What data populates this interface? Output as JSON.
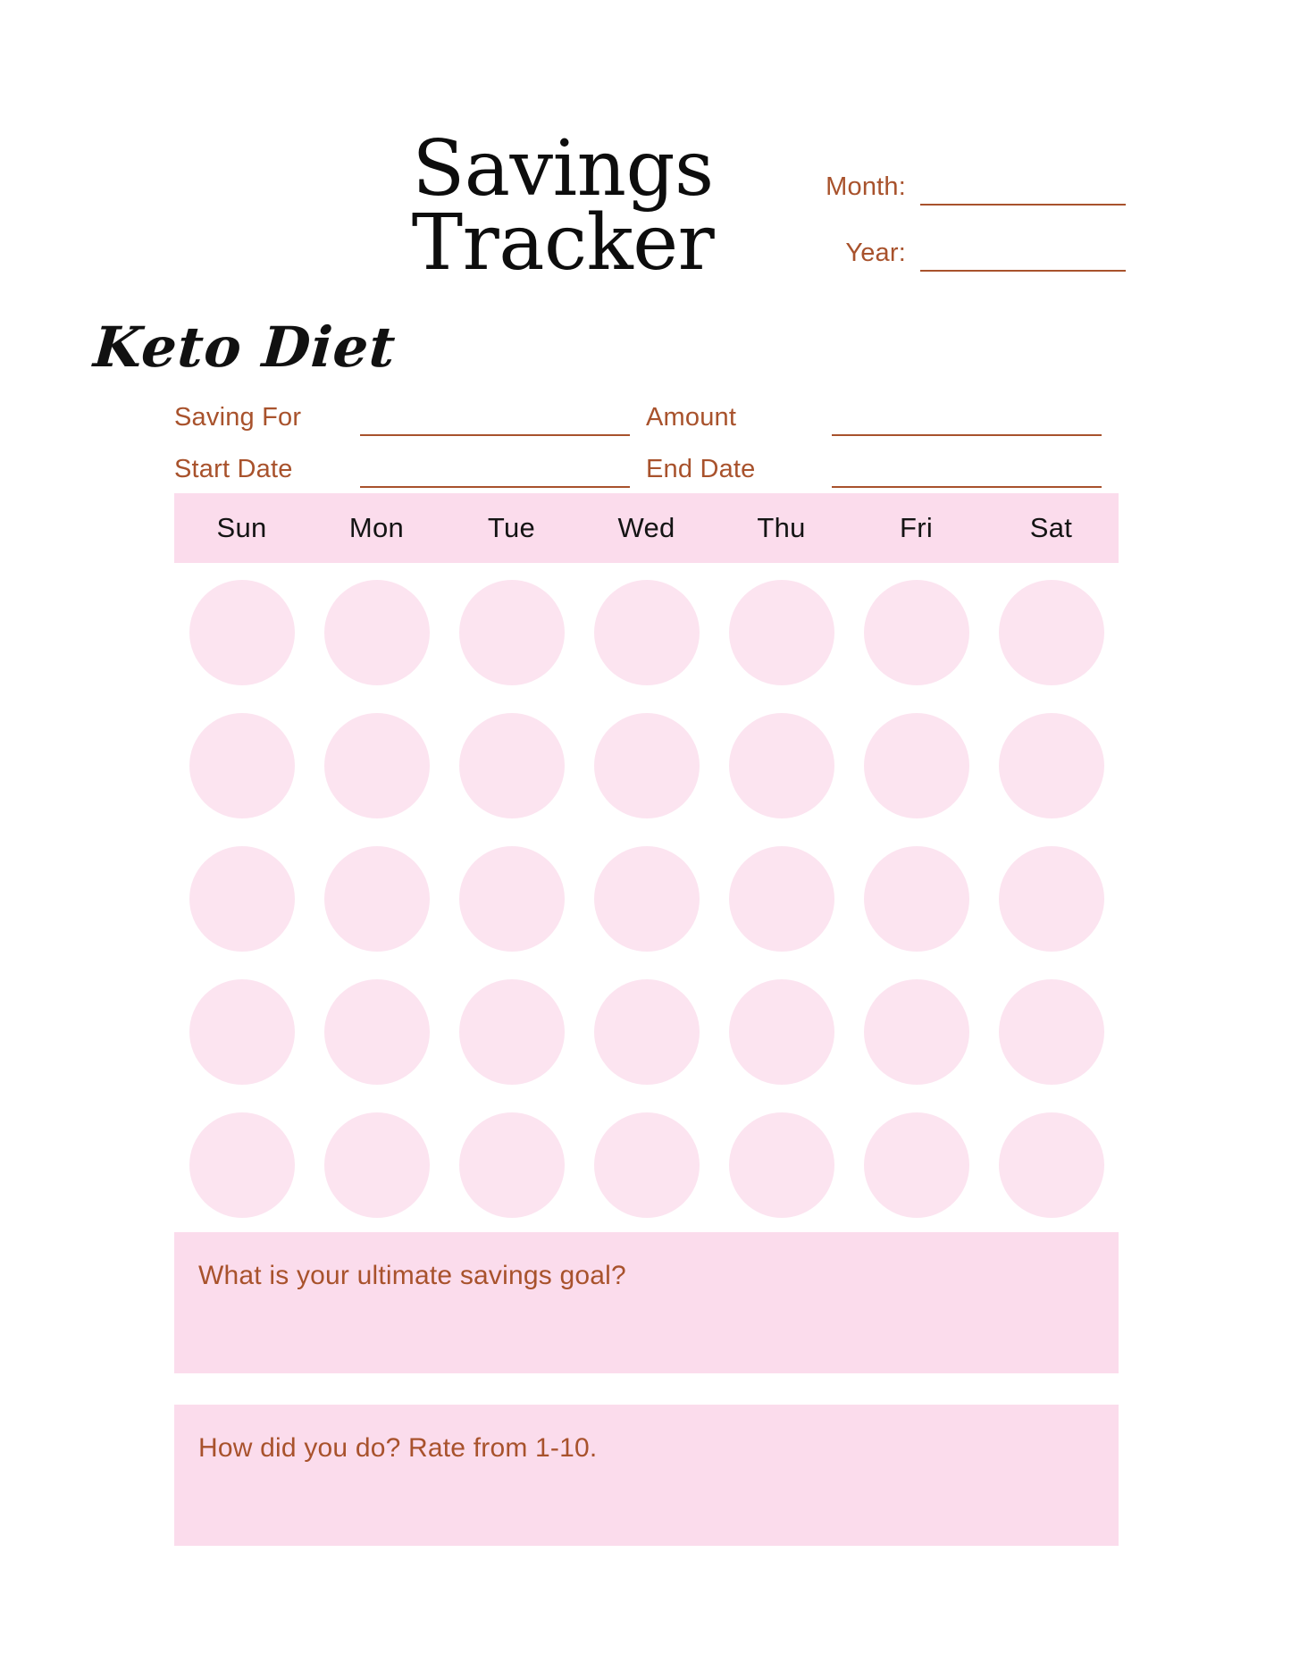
{
  "page": {
    "background": "#ffffff",
    "accent_rust": "#a8522c",
    "band_pink": "#FBDCEC",
    "circle_pink": "#FCE4F0"
  },
  "header": {
    "script_title": "Keto Diet",
    "main_title_line1": "Savings",
    "main_title_line2": "Tracker",
    "month_label": "Month:",
    "year_label": "Year:",
    "month_value": "",
    "year_value": ""
  },
  "fields": {
    "saving_for_label": "Saving For",
    "saving_for_value": "",
    "amount_label": "Amount",
    "amount_value": "",
    "start_date_label": "Start Date",
    "start_date_value": "",
    "end_date_label": "End Date",
    "end_date_value": ""
  },
  "calendar": {
    "weekdays": [
      "Sun",
      "Mon",
      "Tue",
      "Wed",
      "Thu",
      "Fri",
      "Sat"
    ],
    "rows": 5,
    "columns": 7,
    "cells": [
      [
        "",
        "",
        "",
        "",
        "",
        "",
        ""
      ],
      [
        "",
        "",
        "",
        "",
        "",
        "",
        ""
      ],
      [
        "",
        "",
        "",
        "",
        "",
        "",
        ""
      ],
      [
        "",
        "",
        "",
        "",
        "",
        "",
        ""
      ],
      [
        "",
        "",
        "",
        "",
        "",
        "",
        ""
      ]
    ]
  },
  "questions": [
    {
      "prompt": "What is your ultimate savings goal?",
      "answer": ""
    },
    {
      "prompt": "How did you do? Rate from 1-10.",
      "answer": ""
    }
  ]
}
